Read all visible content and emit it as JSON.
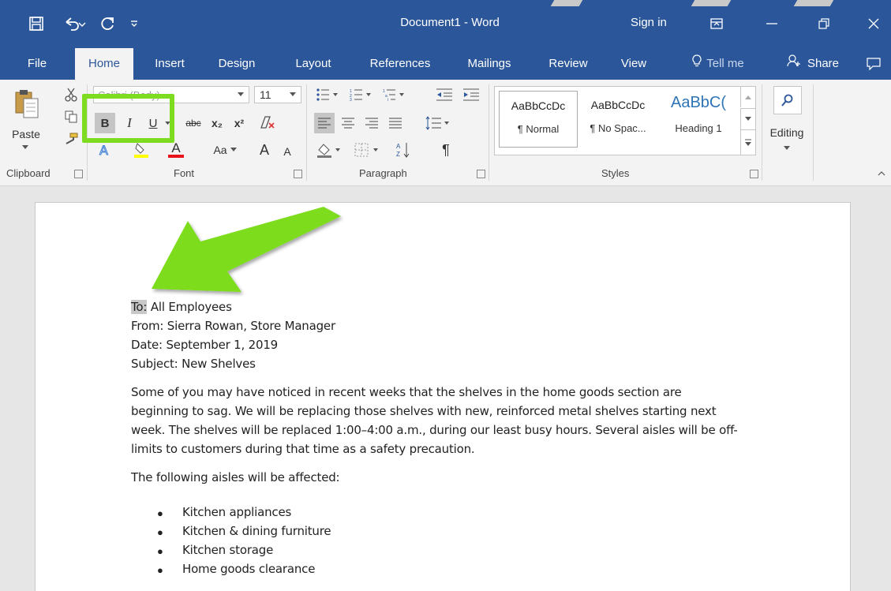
{
  "titlebar": {
    "title": "Document1  -  Word",
    "sign_in": "Sign in"
  },
  "tabs": [
    "File",
    "Home",
    "Insert",
    "Design",
    "Layout",
    "References",
    "Mailings",
    "Review",
    "View"
  ],
  "tell_me": "Tell me",
  "share": "Share",
  "ribbon": {
    "clipboard": {
      "paste": "Paste",
      "label": "Clipboard"
    },
    "font": {
      "font_name": "Calibri (Body)",
      "font_size": "11",
      "bold": "B",
      "italic": "I",
      "underline": "U",
      "strikethrough": "abc",
      "subscript": "x₂",
      "superscript": "x²",
      "change_case": "Aa",
      "grow": "A",
      "shrink": "A",
      "label": "Font"
    },
    "paragraph": {
      "label": "Paragraph",
      "pilcrow": "¶"
    },
    "styles": {
      "label": "Styles",
      "items": [
        {
          "sample": "AaBbCcDc",
          "name": "¶ Normal"
        },
        {
          "sample": "AaBbCcDc",
          "name": "¶ No Spac..."
        },
        {
          "sample": "AaBbC(",
          "name": "Heading 1"
        }
      ]
    },
    "editing": {
      "label": "Editing"
    }
  },
  "document": {
    "to_label": "To:",
    "to_value": " All Employees",
    "from": "From: Sierra Rowan, Store Manager",
    "date": "Date: September 1, 2019",
    "subject": "Subject: New Shelves",
    "para1": [
      "Some of you may have noticed in recent weeks that the shelves in the home goods section are",
      "beginning to sag. We will be replacing those shelves with new, reinforced metal shelves starting next",
      "week. The shelves will be replaced 1:00–4:00 a.m., during our least busy hours. Several aisles will be off-",
      "limits to customers during that time as a safety precaution."
    ],
    "para2": "The following aisles will be affected:",
    "bullets": [
      "Kitchen appliances",
      "Kitchen & dining furniture",
      "Kitchen storage",
      "Home goods clearance"
    ]
  },
  "colors": {
    "accent": "#2b579a",
    "highlight": "#7ddc1f",
    "selection": "#c8c8c8"
  }
}
